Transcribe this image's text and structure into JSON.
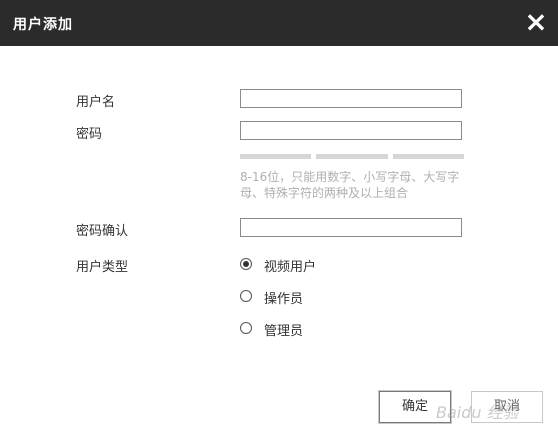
{
  "dialog": {
    "title": "用户添加",
    "close_icon": "×"
  },
  "form": {
    "username_label": "用户名",
    "username_value": "",
    "password_label": "密码",
    "password_value": "",
    "password_hint": "8-16位，只能用数字、小写字母、大写字母、特殊字符的两种及以上组合",
    "confirm_label": "密码确认",
    "confirm_value": "",
    "user_type_label": "用户类型",
    "user_types": [
      {
        "label": "视频用户",
        "checked": true
      },
      {
        "label": "操作员",
        "checked": false
      },
      {
        "label": "管理员",
        "checked": false
      }
    ]
  },
  "buttons": {
    "ok_label": "确定",
    "cancel_label": "取消"
  },
  "watermark": "Baidu 经验"
}
